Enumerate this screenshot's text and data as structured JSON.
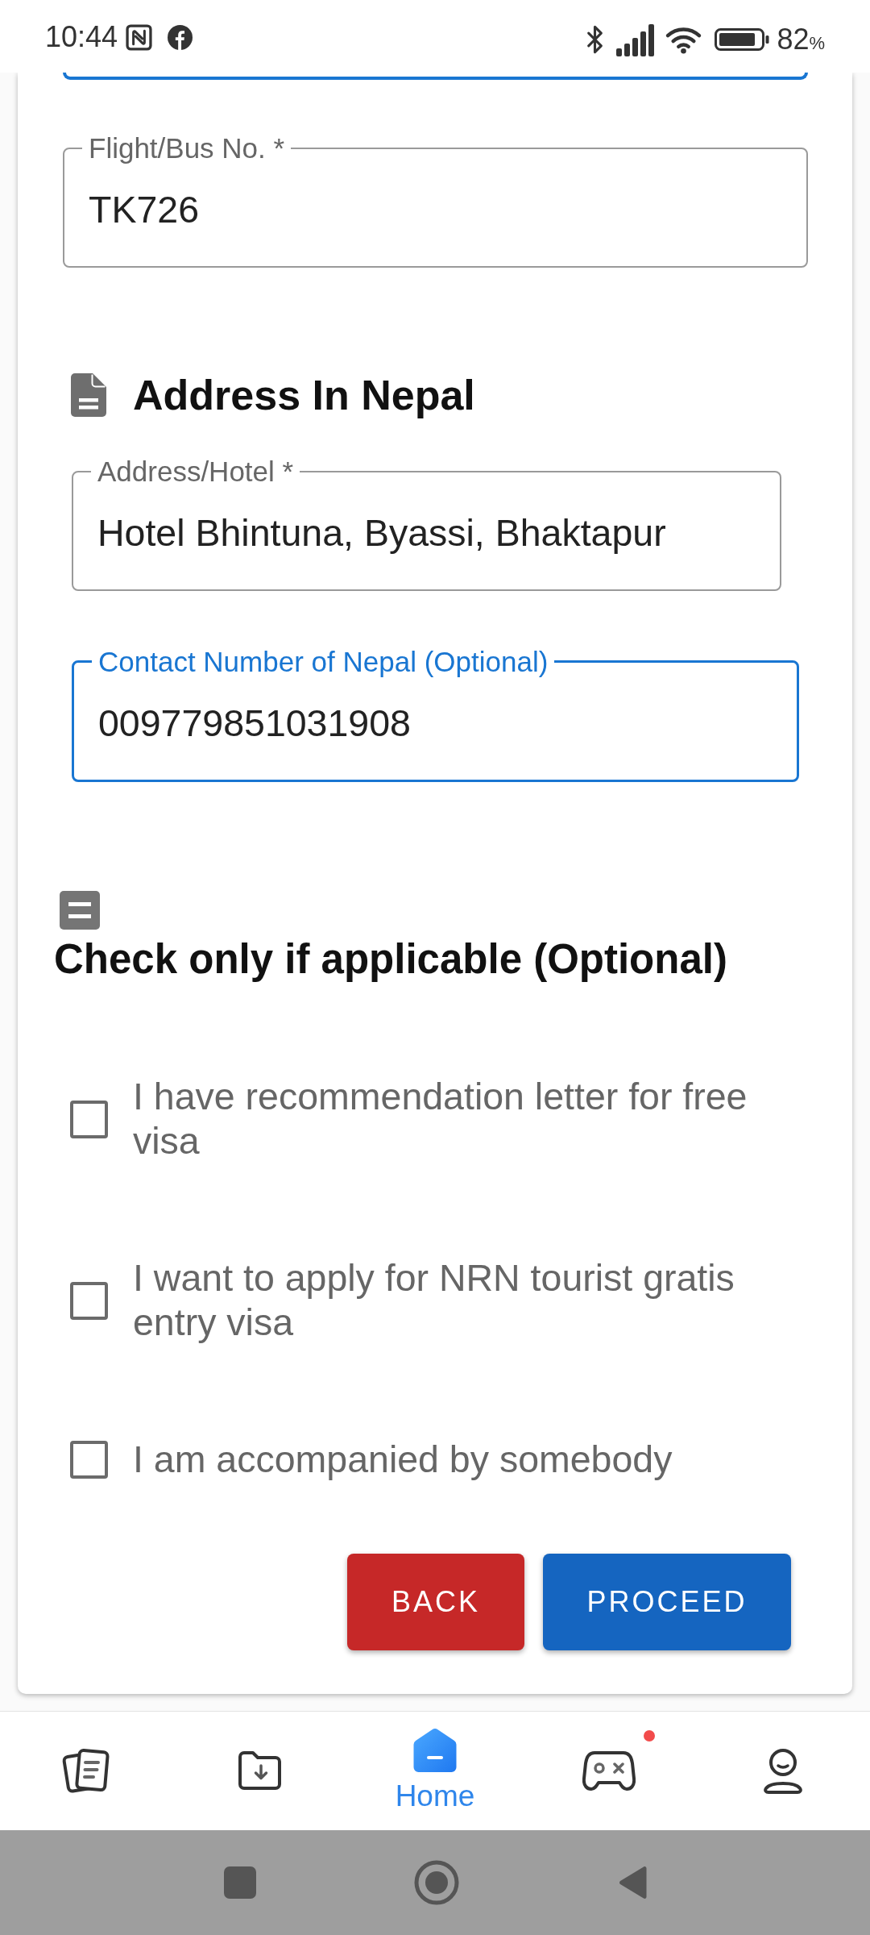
{
  "status_bar": {
    "time": "10:44",
    "battery": "82",
    "battery_unit": "%"
  },
  "form": {
    "fields": [
      {
        "kind": "clipped",
        "focused": true
      },
      {
        "kind": "outlined",
        "label": "Flight/Bus No. *",
        "value": "TK726",
        "focused": false
      }
    ],
    "sections": [
      {
        "kind": "fields",
        "title": "Address In Nepal",
        "fields": [
          {
            "label": "Address/Hotel *",
            "value": "Hotel Bhintuna, Byassi, Bhaktapur",
            "focused": false
          },
          {
            "label": "Contact Number of Nepal (Optional)",
            "value": "009779851031908",
            "focused": true
          }
        ]
      },
      {
        "kind": "checks",
        "title": "Check only if applicable (Optional)",
        "options": [
          {
            "label": "I have recommendation letter for free visa",
            "checked": false
          },
          {
            "label": "I want to apply for NRN tourist gratis entry visa",
            "checked": false
          },
          {
            "label": "I am accompanied by somebody",
            "checked": false
          }
        ]
      }
    ],
    "buttons": [
      {
        "label": "BACK",
        "kind": "danger"
      },
      {
        "label": "PROCEED",
        "kind": "primary"
      }
    ]
  },
  "bottom_nav": {
    "items": [
      {
        "selected": false,
        "dot": false
      },
      {
        "selected": false,
        "dot": false
      },
      {
        "label": "Home",
        "selected": true,
        "dot": false
      },
      {
        "selected": false,
        "dot": true
      },
      {
        "selected": false,
        "dot": false
      }
    ]
  }
}
